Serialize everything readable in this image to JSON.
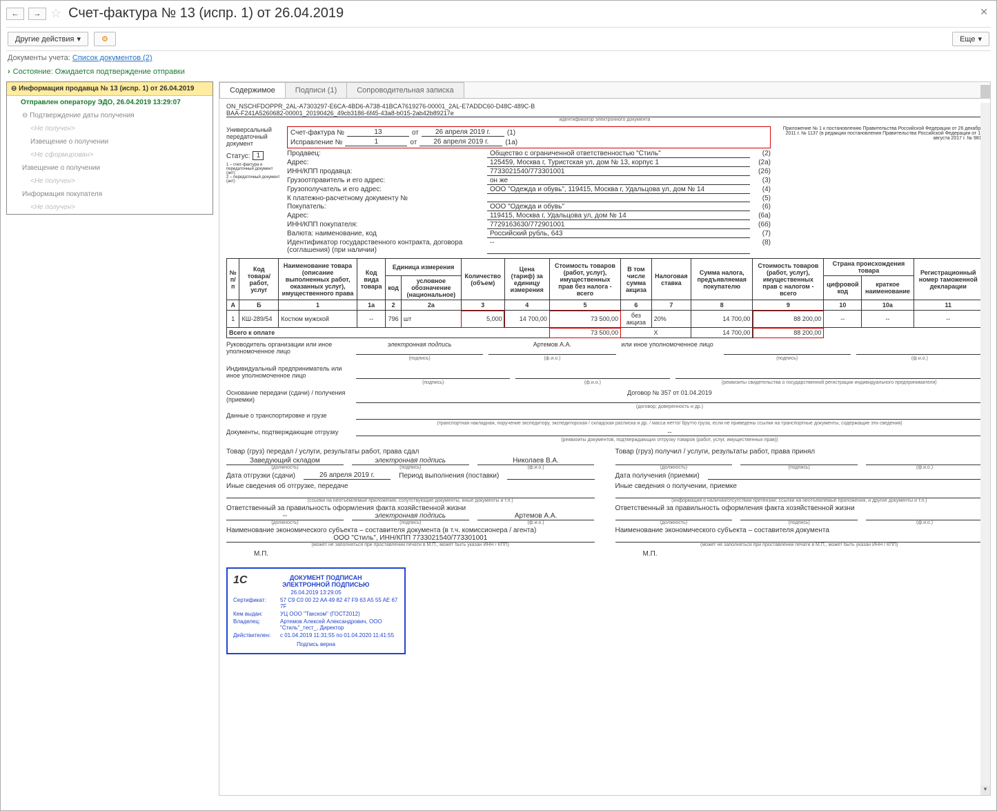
{
  "title": "Счет-фактура № 13 (испр. 1) от 26.04.2019",
  "toolbar": {
    "other_actions": "Другие действия",
    "more": "Еще"
  },
  "docs": {
    "label": "Документы учета:",
    "link": "Список документов (2)"
  },
  "state": "Состояние: Ожидается подтверждение отправки",
  "sidebar": {
    "head": "Информация продавца № 13 (испр. 1) от 26.04.2019",
    "green": "Отправлен оператору ЭДО, 26.04.2019 13:29:07",
    "r1": "Подтверждение даты получения",
    "nf": "<Не получен>",
    "r2": "Извещение о получении",
    "ns": "<Не сформирован>",
    "r3": "Извещение о получении",
    "r4": "Информация покупателя"
  },
  "tabs": {
    "t1": "Содержимое",
    "t2": "Подписи (1)",
    "t3": "Сопроводительная записка"
  },
  "id1": "ON_NSCHFDOPPR_2AL-A7303297-E6CA-4BD6-A738-41BCA7619276-00001_2AL-E7ADDC60-D48C-489C-B",
  "id2": "BAA-F241A5260682-00001_20190426_49cb3186-6f45-43a8-b015-2ab42b89217e",
  "idlabel": "идентификатор электронного документа",
  "univ": "Универсальный передаточный документ",
  "status_lbl": "Статус:",
  "status_val": "1",
  "status_help1": "1 – счет-фактура и передаточный документ (акт)",
  "status_help2": "2 – передаточный документ (акт)",
  "appendix": "Приложение № 1 к постановлению Правительства Российской Федерации от 26 декабря 2011 г. № 1137 (в редакции постановления Правительства Российской Федерации от 19 августа 2017 г. № 981)",
  "sf_lbl": "Счет-фактура №",
  "sf_num": "13",
  "sf_ot": "от",
  "sf_date": "26 апреля 2019 г.",
  "sf_ref": "(1)",
  "isp_lbl": "Исправление №",
  "isp_num": "1",
  "isp_date": "26 апреля 2019 г.",
  "isp_ref": "(1а)",
  "fields": [
    {
      "l": "Продавец:",
      "v": "Общество с ограниченной ответственностью \"Стиль\"",
      "n": "(2)"
    },
    {
      "l": "Адрес:",
      "v": "125459, Москва г, Туристская ул, дом № 13, корпус 1",
      "n": "(2а)"
    },
    {
      "l": "ИНН/КПП продавца:",
      "v": "7733021540/773301001",
      "n": "(2б)"
    },
    {
      "l": "Грузоотправитель и его адрес:",
      "v": "он же",
      "n": "(3)"
    },
    {
      "l": "Грузополучатель и его адрес:",
      "v": "ООО \"Одежда и обувь\", 119415, Москва г, Удальцова ул, дом № 14",
      "n": "(4)"
    },
    {
      "l": "К платежно-расчетному документу №",
      "v": "",
      "n": "(5)"
    },
    {
      "l": "Покупатель:",
      "v": "ООО \"Одежда и обувь\"",
      "n": "(6)"
    },
    {
      "l": "Адрес:",
      "v": "119415, Москва г, Удальцова ул, дом № 14",
      "n": "(6а)"
    },
    {
      "l": "ИНН/КПП покупателя:",
      "v": "7729163630/772901001",
      "n": "(6б)"
    },
    {
      "l": "Валюта: наименование, код",
      "v": "Российский рубль, 643",
      "n": "(7)"
    },
    {
      "l": "Идентификатор государственного контракта, договора (соглашения) (при наличии)",
      "v": "--",
      "n": "(8)"
    }
  ],
  "thead": {
    "c1": "№ п/п",
    "c2": "Код товара/ работ, услуг",
    "c3": "Наименование товара (описание выполненных работ, оказанных услуг), имущественного права",
    "c4": "Код вида товара",
    "c5": "Единица измерения",
    "c5a": "код",
    "c5b": "условное обозначение (национальное)",
    "c6": "Количество (объем)",
    "c7": "Цена (тариф) за единицу измерения",
    "c8": "Стоимость товаров (работ, услуг), имущественных прав без налога - всего",
    "c9": "В том числе сумма акциза",
    "c10": "Налоговая ставка",
    "c11": "Сумма налога, предъявляемая покупателю",
    "c12": "Стоимость товаров (работ, услуг), имущественных прав с налогом - всего",
    "c13": "Страна происхождения товара",
    "c13a": "цифровой код",
    "c13b": "краткое наименование",
    "c14": "Регистрационный номер таможенной декларации",
    "n1": "А",
    "n2": "Б",
    "n3": "1",
    "n4": "1а",
    "n5": "2",
    "n6": "2а",
    "n7": "3",
    "n8": "4",
    "n9": "5",
    "n10": "6",
    "n11": "7",
    "n12": "8",
    "n13": "9",
    "n14": "10",
    "n15": "10а",
    "n16": "11"
  },
  "row": {
    "num": "1",
    "code": "КШ-289/54",
    "name": "Костюм мужской",
    "kind": "--",
    "ucode": "796",
    "uname": "шт",
    "qty": "5,000",
    "price": "14 700,00",
    "sum_no_tax": "73 500,00",
    "excise": "без акциза",
    "rate": "20%",
    "tax": "14 700,00",
    "sum_tax": "88 200,00",
    "cc": "--",
    "cn": "--",
    "decl": "--"
  },
  "total": {
    "lbl": "Всего к оплате",
    "s1": "73 500,00",
    "x": "Х",
    "tax": "14 700,00",
    "s2": "88 200,00"
  },
  "sig": {
    "head1": "Руководитель организации или иное уполномоченное лицо",
    "ep": "электронная подпись",
    "name1": "Артемов А.А.",
    "head2": "или иное уполномоченное лицо",
    "ind": "Индивидуальный предприниматель или иное уполномоченное лицо",
    "sub_p": "(подпись)",
    "sub_f": "(ф.и.о.)",
    "sub_r": "(реквизиты свидетельства о государственной регистрации индивидуального предпринимателя)"
  },
  "basis_lbl": "Основание передачи (сдачи) / получения (приемки)",
  "basis_val": "Договор № 357 от 01.04.2019",
  "basis_sub": "(договор; доверенность и др.)",
  "trans_lbl": "Данные о транспортировке и грузе",
  "trans_sub": "(транспортная накладная, поручение экспедитору, экспедиторская / складская расписка и др. / масса нетто/ брутто груза, если не приведены ссылки на транспортные документы, содержащие эти сведения)",
  "confirm_lbl": "Документы, подтверждающие отгрузку",
  "confirm_val": "--",
  "confirm_sub": "(реквизиты документов, подтверждающих отгрузку товаров (работ, услуг, имущественных прав))",
  "left_col": {
    "t1": "Товар (груз) передал / услуги, результаты работ, права сдал",
    "r1a": "Заведующий складом",
    "r1b": "электронная подпись",
    "r1c": "Николаев В.А.",
    "sub_d": "(должность)",
    "sub_p": "(подпись)",
    "sub_f": "(ф.и.о.)",
    "r2a": "Дата отгрузки (сдачи)",
    "r2b": "26 апреля 2019 г.",
    "r2c": "Период выполнения (поставки)",
    "r3": "Иные сведения об отгрузке, передаче",
    "r3sub": "(ссылки на неотъемлемые приложения, сопутствующие документы, иные документы и т.п.)",
    "r4": "Ответственный за правильность оформления факта хозяйственной жизни",
    "r4a": "--",
    "r4b": "электронная подпись",
    "r4c": "Артемов А.А.",
    "r5": "Наименование экономического субъекта – составителя документа (в т.ч. комиссионера / агента)",
    "r5v": "ООО \"Стиль\", ИНН/КПП 7733021540/773301001",
    "r5sub": "(может не заполняться при проставлении печати в М.П., может быть указан ИНН / КПП)",
    "mp": "М.П."
  },
  "right_col": {
    "t1": "Товар (груз) получил / услуги, результаты работ, права принял",
    "r2a": "Дата получения (приемки)",
    "r3": "Иные сведения о получении, приемке",
    "r3sub": "(информация о наличии/отсутствии претензии; ссылки на неотъемлемые приложения, и другие документы и т.п.)",
    "r4": "Ответственный за правильность оформления факта хозяйственной жизни",
    "r5": "Наименование экономического субъекта – составителя документа",
    "r5sub": "(может не заполняться при проставлении печати в М.П., может быть указан ИНН / КПП)",
    "mp": "М.П."
  },
  "stamp": {
    "t1": "ДОКУМЕНТ ПОДПИСАН",
    "t2": "ЭЛЕКТРОННОЙ ПОДПИСЬЮ",
    "dt": "26.04.2019 13:29:05",
    "l1": "Сертификат:",
    "v1": "57 C9 C0 00 22 AA 49 82 47 F9 63 A5 55 AE 67 7F",
    "l2": "Кем выдан:",
    "v2": "УЦ ООО \"Такском\" (ГОСТ2012)",
    "l3": "Владелец:",
    "v3": "Артемов Алексей Александрович, ООО \"Стиль\"_тест_, Директор",
    "l4": "Действителен:",
    "v4": "с 01.04.2019 11:31:55 по 01.04.2020 11:41:55",
    "foot": "Подпись верна"
  }
}
